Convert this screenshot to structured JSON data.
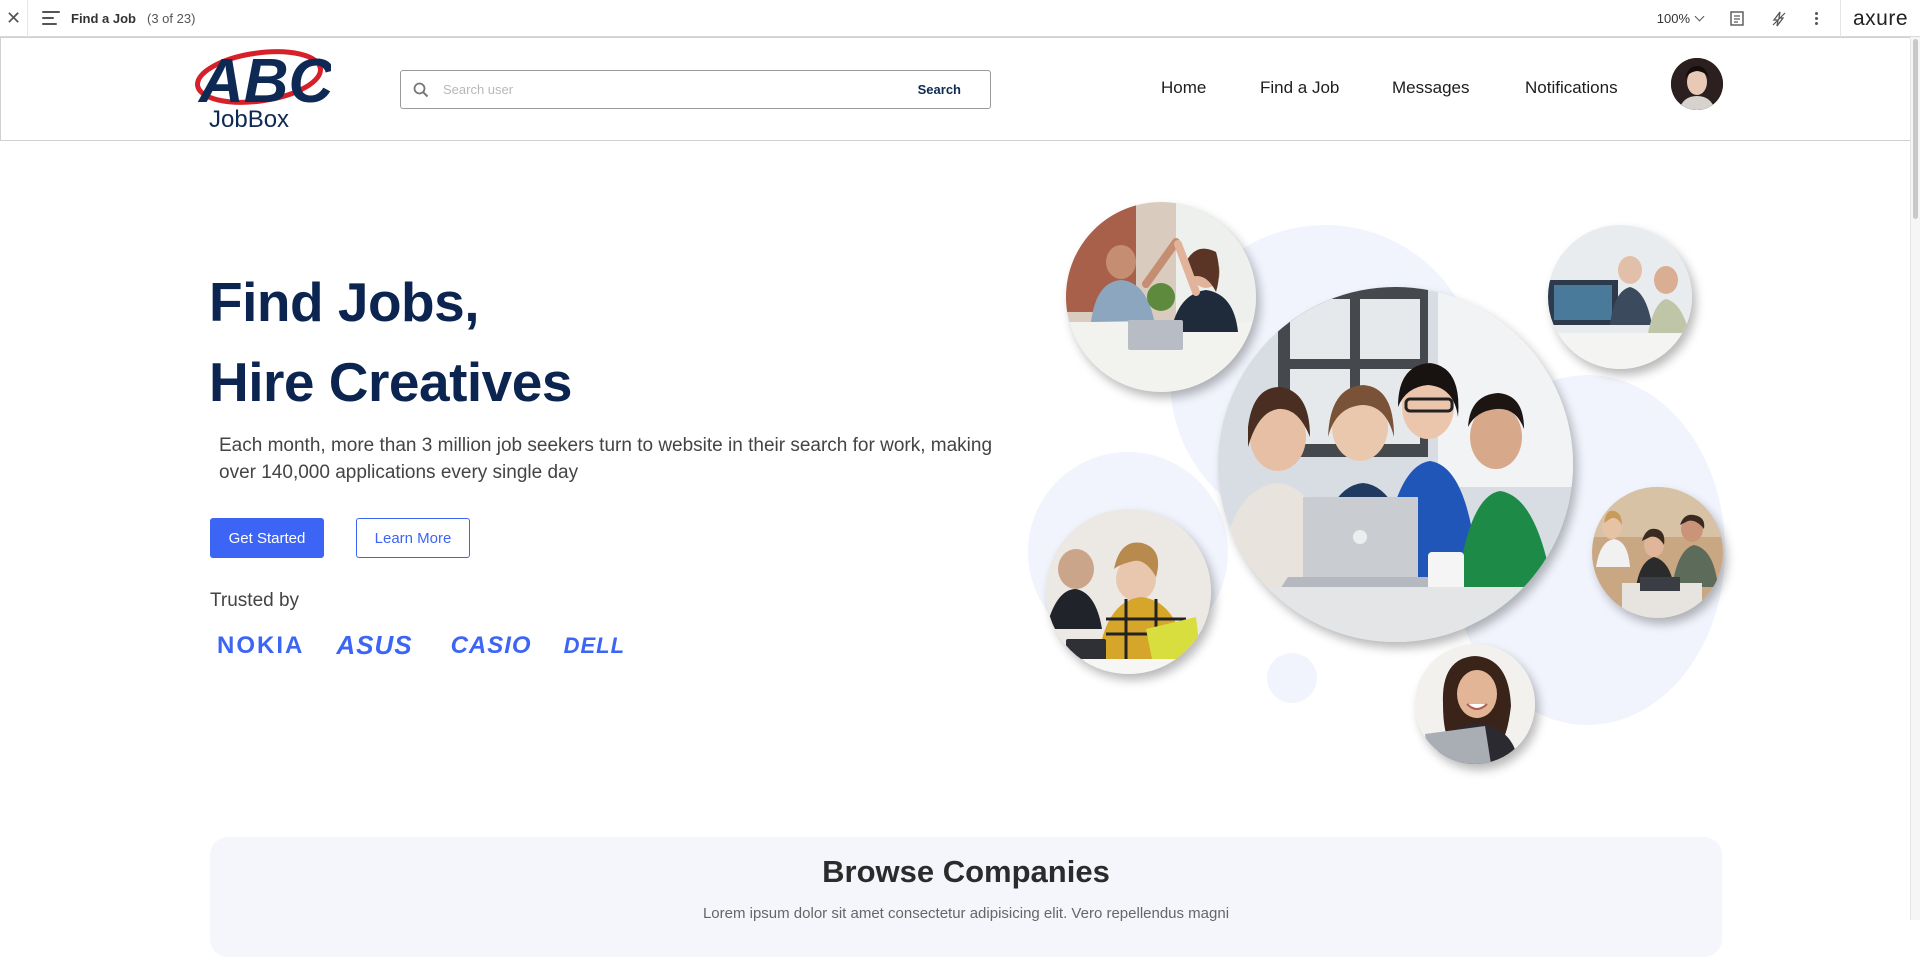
{
  "axure_bar": {
    "page_name": "Find a Job",
    "page_count": "(3 of 23)",
    "zoom": "100%",
    "brand": "axure"
  },
  "header": {
    "logo_text": "ABC",
    "logo_wordmark": "JobBox",
    "search_placeholder": "Search user",
    "search_button": "Search",
    "nav": [
      "Home",
      "Find a Job",
      "Messages",
      "Notifications"
    ]
  },
  "hero": {
    "title_line1": "Find Jobs,",
    "title_line2": "Hire Creatives",
    "subtitle": "Each month, more than 3 million job seekers turn to website in their search for work, making over 140,000 applications every single day",
    "primary_button": "Get Started",
    "secondary_button": "Learn More",
    "trusted_label": "Trusted by",
    "trusted_brands": [
      "NOKIA",
      "ASUS",
      "CASIO",
      "DELL"
    ]
  },
  "browse": {
    "title": "Browse Companies",
    "subtitle": "Lorem ipsum dolor sit amet consectetur adipisicing elit. Vero repellendus magni"
  },
  "colors": {
    "accent": "#3c65f5",
    "navy": "#0b2450",
    "logo_red": "#d6202a",
    "bubble_bg": "#f1f4fd"
  }
}
